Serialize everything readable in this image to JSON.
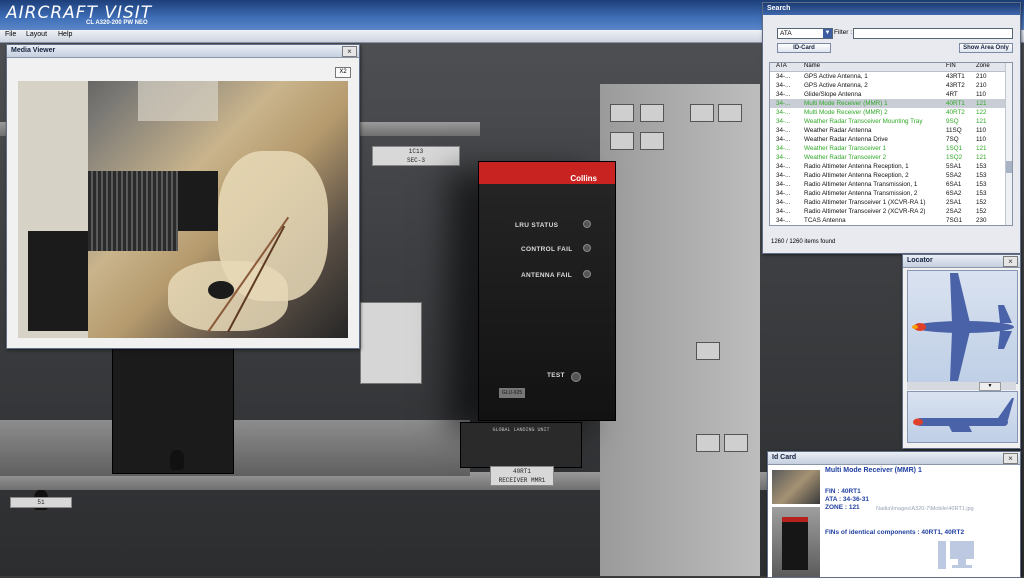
{
  "app": {
    "title_bold": "AIRCRAFT",
    "title_light": " VISIT",
    "subtitle": "CL A320-200 PW NEO"
  },
  "menu": [
    "File",
    "Layout",
    "Help"
  ],
  "scene": {
    "plate_left": "1C13\nSEC-3",
    "lru_brand": "Collins",
    "lru_labels": [
      "LRU STATUS",
      "CONTROL FAIL",
      "ANTENNA FAIL",
      "TEST"
    ],
    "lru_tag": "GLU-925",
    "unit_plate": "GLOBAL LANDING UNIT",
    "label_bottom": "40RT1\nRECEIVER MMR1",
    "label_left": "51"
  },
  "media_viewer": {
    "title": "Media Viewer",
    "zoom_button": "X2",
    "close": "×"
  },
  "search": {
    "title": "Search",
    "select_value": "ATA",
    "filter_label": "Filter :",
    "filter_value": "",
    "id_card_button": "ID-Card",
    "show_area_button": "Show Area Only",
    "columns": [
      "ATA",
      "Name",
      "FIN",
      "Zone"
    ],
    "rows": [
      {
        "ata": "34-...",
        "name": "GPS Active Antenna, 1",
        "fin": "43RT1",
        "zone": "210",
        "state": "normal"
      },
      {
        "ata": "34-...",
        "name": "GPS Active Antenna, 2",
        "fin": "43RT2",
        "zone": "210",
        "state": "normal"
      },
      {
        "ata": "34-...",
        "name": "Glide/Slope Antenna",
        "fin": "4RT",
        "zone": "110",
        "state": "normal"
      },
      {
        "ata": "34-...",
        "name": "Multi Mode Receiver (MMR) 1",
        "fin": "40RT1",
        "zone": "121",
        "state": "selected"
      },
      {
        "ata": "34-...",
        "name": "Multi Mode Receiver (MMR) 2",
        "fin": "40RT2",
        "zone": "122",
        "state": "green"
      },
      {
        "ata": "34-...",
        "name": "Weather Radar Transceiver Mounting Tray",
        "fin": "9SQ",
        "zone": "121",
        "state": "green"
      },
      {
        "ata": "34-...",
        "name": "Weather Radar Antenna",
        "fin": "11SQ",
        "zone": "110",
        "state": "normal"
      },
      {
        "ata": "34-...",
        "name": "Weather Radar Antenna Drive",
        "fin": "7SQ",
        "zone": "110",
        "state": "normal"
      },
      {
        "ata": "34-...",
        "name": "Weather Radar Transceiver 1",
        "fin": "1SQ1",
        "zone": "121",
        "state": "green"
      },
      {
        "ata": "34-...",
        "name": "Weather Radar Transceiver 2",
        "fin": "1SQ2",
        "zone": "121",
        "state": "green"
      },
      {
        "ata": "34-...",
        "name": "Radio Altimeter Antenna Reception, 1",
        "fin": "5SA1",
        "zone": "153",
        "state": "normal"
      },
      {
        "ata": "34-...",
        "name": "Radio Altimeter Antenna Reception, 2",
        "fin": "5SA2",
        "zone": "153",
        "state": "normal"
      },
      {
        "ata": "34-...",
        "name": "Radio Altimeter Antenna Transmission, 1",
        "fin": "6SA1",
        "zone": "153",
        "state": "normal"
      },
      {
        "ata": "34-...",
        "name": "Radio Altimeter Antenna Transmission, 2",
        "fin": "6SA2",
        "zone": "153",
        "state": "normal"
      },
      {
        "ata": "34-...",
        "name": "Radio Altimeter Transceiver 1 (XCVR-RA 1)",
        "fin": "2SA1",
        "zone": "152",
        "state": "normal"
      },
      {
        "ata": "34-...",
        "name": "Radio Altimeter Transceiver 2 (XCVR-RA 2)",
        "fin": "2SA2",
        "zone": "152",
        "state": "normal"
      },
      {
        "ata": "34-...",
        "name": "TCAS Antenna",
        "fin": "7SG1",
        "zone": "230",
        "state": "normal"
      }
    ],
    "status": "1260 / 1260 items found"
  },
  "locator": {
    "title": "Locator",
    "close": "×"
  },
  "id_card": {
    "title": "Id Card",
    "close": "×",
    "name": "Multi Mode Receiver (MMR) 1",
    "fin": "FIN : 40RT1",
    "ata": "ATA : 34-36-31",
    "zone": "ZONE : 121",
    "identical": "FINs of identical components : 40RT1, 40RT2",
    "path_hint": "Nadia\\Images\\A320-7\\Mobile\\40RT1.jpg"
  },
  "colors": {
    "accent_blue": "#1f3fa0",
    "green_rows": "#2fa826",
    "lru_red": "#c82320",
    "locator_marker": "#e0402a"
  }
}
